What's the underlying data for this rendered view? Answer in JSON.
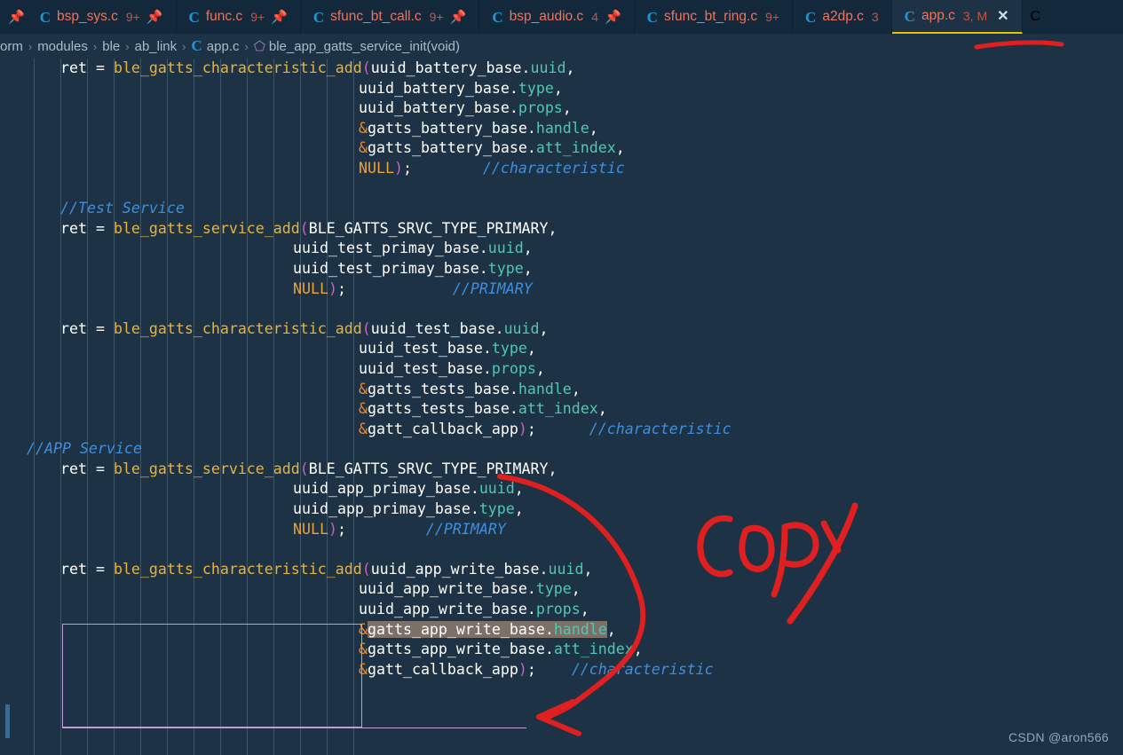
{
  "window": {
    "app": "Visual Studio Code",
    "theme_bg": "#1d3244",
    "tabbar_bg": "#14283c",
    "accent_underline": "#e5c100",
    "annotation_color": "#e02020"
  },
  "tabbar": {
    "left_edge_pin_icon": "pin-icon",
    "tabs": [
      {
        "lang_icon": "c-file-icon",
        "name": "bsp_sys.c",
        "badge": "9+",
        "pinned": true,
        "active": false,
        "closable": false
      },
      {
        "lang_icon": "c-file-icon",
        "name": "func.c",
        "badge": "9+",
        "pinned": true,
        "active": false,
        "closable": false
      },
      {
        "lang_icon": "c-file-icon",
        "name": "sfunc_bt_call.c",
        "badge": "9+",
        "pinned": true,
        "active": false,
        "closable": false
      },
      {
        "lang_icon": "c-file-icon",
        "name": "bsp_audio.c",
        "badge": "4",
        "pinned": true,
        "active": false,
        "closable": false
      },
      {
        "lang_icon": "c-file-icon",
        "name": "sfunc_bt_ring.c",
        "badge": "9+",
        "pinned": false,
        "active": false,
        "closable": false
      },
      {
        "lang_icon": "c-file-icon",
        "name": "a2dp.c",
        "badge": "3",
        "pinned": false,
        "active": false,
        "closable": false
      },
      {
        "lang_icon": "c-file-icon",
        "name": "app.c",
        "badge": "3, M",
        "pinned": false,
        "active": true,
        "closable": true
      }
    ],
    "close_icon": "close-icon",
    "overflow_icon": "c-file-icon"
  },
  "breadcrumb": {
    "items": [
      "orm",
      "modules",
      "ble",
      "ab_link",
      "app.c",
      "ble_app_gatts_service_init(void)"
    ],
    "separator": "›",
    "file_icon": "c-file-icon",
    "symbol_icon": "cube-symbol-icon"
  },
  "editor": {
    "language": "c",
    "selected_text": "&gatts_app_write_base.handle",
    "lines": [
      {
        "indent": 68,
        "parts": [
          {
            "t": "ret ",
            "c": "plain"
          },
          {
            "t": "= ",
            "c": "eq"
          },
          {
            "t": "ble_gatts_characteristic_add",
            "c": "kw-fn"
          },
          {
            "t": "(",
            "c": "paren"
          },
          {
            "t": "uuid_battery_base",
            "c": "plain"
          },
          {
            "t": ".",
            "c": "plain"
          },
          {
            "t": "uuid",
            "c": "member"
          },
          {
            "t": ",",
            "c": "plain"
          }
        ]
      },
      {
        "indent": 404,
        "parts": [
          {
            "t": "uuid_battery_base",
            "c": "plain"
          },
          {
            "t": ".",
            "c": "plain"
          },
          {
            "t": "type",
            "c": "member"
          },
          {
            "t": ",",
            "c": "plain"
          }
        ]
      },
      {
        "indent": 404,
        "parts": [
          {
            "t": "uuid_battery_base",
            "c": "plain"
          },
          {
            "t": ".",
            "c": "plain"
          },
          {
            "t": "props",
            "c": "member"
          },
          {
            "t": ",",
            "c": "plain"
          }
        ]
      },
      {
        "indent": 404,
        "parts": [
          {
            "t": "&",
            "c": "amp"
          },
          {
            "t": "gatts_battery_base",
            "c": "plain"
          },
          {
            "t": ".",
            "c": "plain"
          },
          {
            "t": "handle",
            "c": "member"
          },
          {
            "t": ",",
            "c": "plain"
          }
        ]
      },
      {
        "indent": 404,
        "parts": [
          {
            "t": "&",
            "c": "amp"
          },
          {
            "t": "gatts_battery_base",
            "c": "plain"
          },
          {
            "t": ".",
            "c": "plain"
          },
          {
            "t": "att_index",
            "c": "member"
          },
          {
            "t": ",",
            "c": "plain"
          }
        ]
      },
      {
        "indent": 404,
        "parts": [
          {
            "t": "NULL",
            "c": "kw-null"
          },
          {
            "t": ")",
            "c": "paren"
          },
          {
            "t": ";",
            "c": "plain"
          },
          {
            "t": "        ",
            "c": "plain"
          },
          {
            "t": "//characteristic",
            "c": "cmt"
          }
        ]
      },
      {
        "indent": 0,
        "parts": []
      },
      {
        "indent": 68,
        "parts": [
          {
            "t": "//Test Service",
            "c": "cmt"
          }
        ]
      },
      {
        "indent": 68,
        "parts": [
          {
            "t": "ret ",
            "c": "plain"
          },
          {
            "t": "= ",
            "c": "eq"
          },
          {
            "t": "ble_gatts_service_add",
            "c": "kw-fn"
          },
          {
            "t": "(",
            "c": "paren"
          },
          {
            "t": "BLE_GATTS_SRVC_TYPE_PRIMARY",
            "c": "plain"
          },
          {
            "t": ",",
            "c": "plain"
          }
        ]
      },
      {
        "indent": 330,
        "parts": [
          {
            "t": "uuid_test_primay_base",
            "c": "plain"
          },
          {
            "t": ".",
            "c": "plain"
          },
          {
            "t": "uuid",
            "c": "member"
          },
          {
            "t": ",",
            "c": "plain"
          }
        ]
      },
      {
        "indent": 330,
        "parts": [
          {
            "t": "uuid_test_primay_base",
            "c": "plain"
          },
          {
            "t": ".",
            "c": "plain"
          },
          {
            "t": "type",
            "c": "member"
          },
          {
            "t": ",",
            "c": "plain"
          }
        ]
      },
      {
        "indent": 330,
        "parts": [
          {
            "t": "NULL",
            "c": "kw-null"
          },
          {
            "t": ")",
            "c": "paren"
          },
          {
            "t": ";",
            "c": "plain"
          },
          {
            "t": "            ",
            "c": "plain"
          },
          {
            "t": "//PRIMARY",
            "c": "cmt"
          }
        ]
      },
      {
        "indent": 0,
        "parts": []
      },
      {
        "indent": 68,
        "parts": [
          {
            "t": "ret ",
            "c": "plain"
          },
          {
            "t": "= ",
            "c": "eq"
          },
          {
            "t": "ble_gatts_characteristic_add",
            "c": "kw-fn"
          },
          {
            "t": "(",
            "c": "paren"
          },
          {
            "t": "uuid_test_base",
            "c": "plain"
          },
          {
            "t": ".",
            "c": "plain"
          },
          {
            "t": "uuid",
            "c": "member"
          },
          {
            "t": ",",
            "c": "plain"
          }
        ]
      },
      {
        "indent": 404,
        "parts": [
          {
            "t": "uuid_test_base",
            "c": "plain"
          },
          {
            "t": ".",
            "c": "plain"
          },
          {
            "t": "type",
            "c": "member"
          },
          {
            "t": ",",
            "c": "plain"
          }
        ]
      },
      {
        "indent": 404,
        "parts": [
          {
            "t": "uuid_test_base",
            "c": "plain"
          },
          {
            "t": ".",
            "c": "plain"
          },
          {
            "t": "props",
            "c": "member"
          },
          {
            "t": ",",
            "c": "plain"
          }
        ]
      },
      {
        "indent": 404,
        "parts": [
          {
            "t": "&",
            "c": "amp"
          },
          {
            "t": "gatts_tests_base",
            "c": "plain"
          },
          {
            "t": ".",
            "c": "plain"
          },
          {
            "t": "handle",
            "c": "member"
          },
          {
            "t": ",",
            "c": "plain"
          }
        ]
      },
      {
        "indent": 404,
        "parts": [
          {
            "t": "&",
            "c": "amp"
          },
          {
            "t": "gatts_tests_base",
            "c": "plain"
          },
          {
            "t": ".",
            "c": "plain"
          },
          {
            "t": "att_index",
            "c": "member"
          },
          {
            "t": ",",
            "c": "plain"
          }
        ]
      },
      {
        "indent": 404,
        "parts": [
          {
            "t": "&",
            "c": "amp"
          },
          {
            "t": "gatt_callback_app",
            "c": "plain"
          },
          {
            "t": ")",
            "c": "paren"
          },
          {
            "t": ";",
            "c": "plain"
          },
          {
            "t": "      ",
            "c": "plain"
          },
          {
            "t": "//characteristic",
            "c": "cmt"
          }
        ]
      },
      {
        "indent": 30,
        "parts": [
          {
            "t": "//APP Service",
            "c": "cmt"
          }
        ]
      },
      {
        "indent": 68,
        "parts": [
          {
            "t": "ret ",
            "c": "plain"
          },
          {
            "t": "= ",
            "c": "eq"
          },
          {
            "t": "ble_gatts_service_add",
            "c": "kw-fn"
          },
          {
            "t": "(",
            "c": "paren"
          },
          {
            "t": "BLE_GATTS_SRVC_TYPE_PRIMARY",
            "c": "plain"
          },
          {
            "t": ",",
            "c": "plain"
          }
        ]
      },
      {
        "indent": 330,
        "parts": [
          {
            "t": "uuid_app_primay_base",
            "c": "plain"
          },
          {
            "t": ".",
            "c": "plain"
          },
          {
            "t": "uuid",
            "c": "member"
          },
          {
            "t": ",",
            "c": "plain"
          }
        ]
      },
      {
        "indent": 330,
        "parts": [
          {
            "t": "uuid_app_primay_base",
            "c": "plain"
          },
          {
            "t": ".",
            "c": "plain"
          },
          {
            "t": "type",
            "c": "member"
          },
          {
            "t": ",",
            "c": "plain"
          }
        ]
      },
      {
        "indent": 330,
        "parts": [
          {
            "t": "NULL",
            "c": "kw-null"
          },
          {
            "t": ")",
            "c": "paren"
          },
          {
            "t": ";",
            "c": "plain"
          },
          {
            "t": "         ",
            "c": "plain"
          },
          {
            "t": "//PRIMARY",
            "c": "cmt"
          }
        ]
      },
      {
        "indent": 0,
        "parts": []
      },
      {
        "indent": 68,
        "parts": [
          {
            "t": "ret ",
            "c": "plain"
          },
          {
            "t": "= ",
            "c": "eq"
          },
          {
            "t": "ble_gatts_characteristic_add",
            "c": "kw-fn"
          },
          {
            "t": "(",
            "c": "paren"
          },
          {
            "t": "uuid_app_write_base",
            "c": "plain"
          },
          {
            "t": ".",
            "c": "plain"
          },
          {
            "t": "uuid",
            "c": "member"
          },
          {
            "t": ",",
            "c": "plain"
          }
        ]
      },
      {
        "indent": 404,
        "parts": [
          {
            "t": "uuid_app_write_base",
            "c": "plain"
          },
          {
            "t": ".",
            "c": "plain"
          },
          {
            "t": "type",
            "c": "member"
          },
          {
            "t": ",",
            "c": "plain"
          }
        ]
      },
      {
        "indent": 404,
        "parts": [
          {
            "t": "uuid_app_write_base",
            "c": "plain"
          },
          {
            "t": ".",
            "c": "plain"
          },
          {
            "t": "props",
            "c": "member"
          },
          {
            "t": ",",
            "c": "plain"
          }
        ]
      },
      {
        "indent": 404,
        "parts": [
          {
            "t": "&",
            "c": "amp"
          },
          {
            "t": "gatts_app_write_base",
            "c": "plain sel-hl"
          },
          {
            "t": ".",
            "c": "plain sel-hl"
          },
          {
            "t": "handle",
            "c": "member sel-hl"
          },
          {
            "t": ",",
            "c": "plain"
          }
        ]
      },
      {
        "indent": 404,
        "parts": [
          {
            "t": "&",
            "c": "amp"
          },
          {
            "t": "gatts_app_write_base",
            "c": "plain"
          },
          {
            "t": ".",
            "c": "plain"
          },
          {
            "t": "att_index",
            "c": "member"
          },
          {
            "t": ",",
            "c": "plain"
          }
        ]
      },
      {
        "indent": 404,
        "parts": [
          {
            "t": "&",
            "c": "amp"
          },
          {
            "t": "gatt_callback_app",
            "c": "plain"
          },
          {
            "t": ")",
            "c": "paren"
          },
          {
            "t": ";",
            "c": "plain"
          },
          {
            "t": "    ",
            "c": "plain"
          },
          {
            "t": "//characteristic",
            "c": "cmt"
          }
        ]
      }
    ]
  },
  "annotations": {
    "copy_text": "COPY",
    "copy_note": "hand-drawn red marker",
    "tab_underline_note": "red hand-drawn arc under active tab",
    "arrow_note": "red hand-drawn curved arrow from test characteristic call down to app write characteristic call"
  },
  "watermark": {
    "text": "CSDN @aron566"
  }
}
